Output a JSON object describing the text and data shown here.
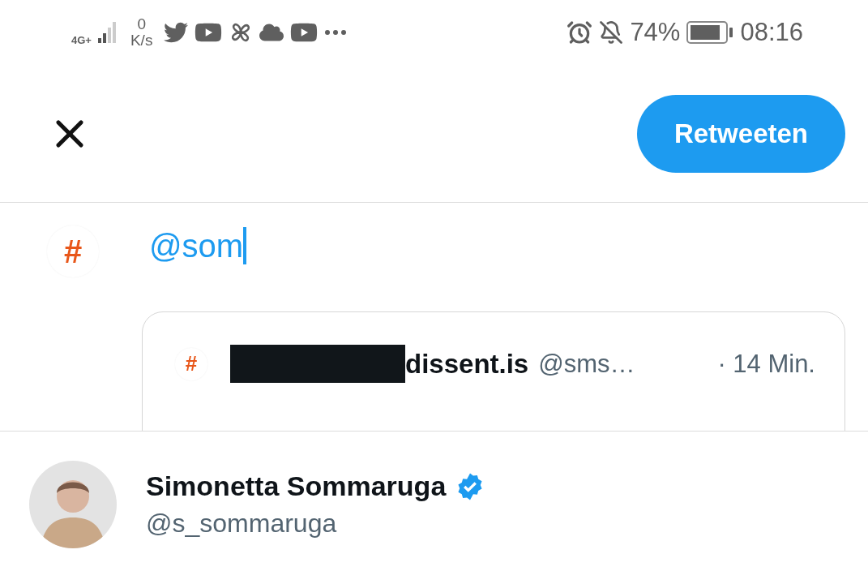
{
  "status_bar": {
    "network": "4G+",
    "speed_value": "0",
    "speed_unit": "K/s",
    "battery": "74%",
    "time": "08:16"
  },
  "header": {
    "retweet_button": "Retweeten"
  },
  "compose": {
    "avatar_symbol": "#",
    "text": "@som"
  },
  "quoted_tweet": {
    "avatar_symbol": "#",
    "name_redacted": true,
    "name": "dissent.is",
    "handle": "@sms…",
    "time": "· 14 Min."
  },
  "suggestions": [
    {
      "name": "Simonetta Sommaruga",
      "handle": "@s_sommaruga",
      "verified": true
    }
  ]
}
